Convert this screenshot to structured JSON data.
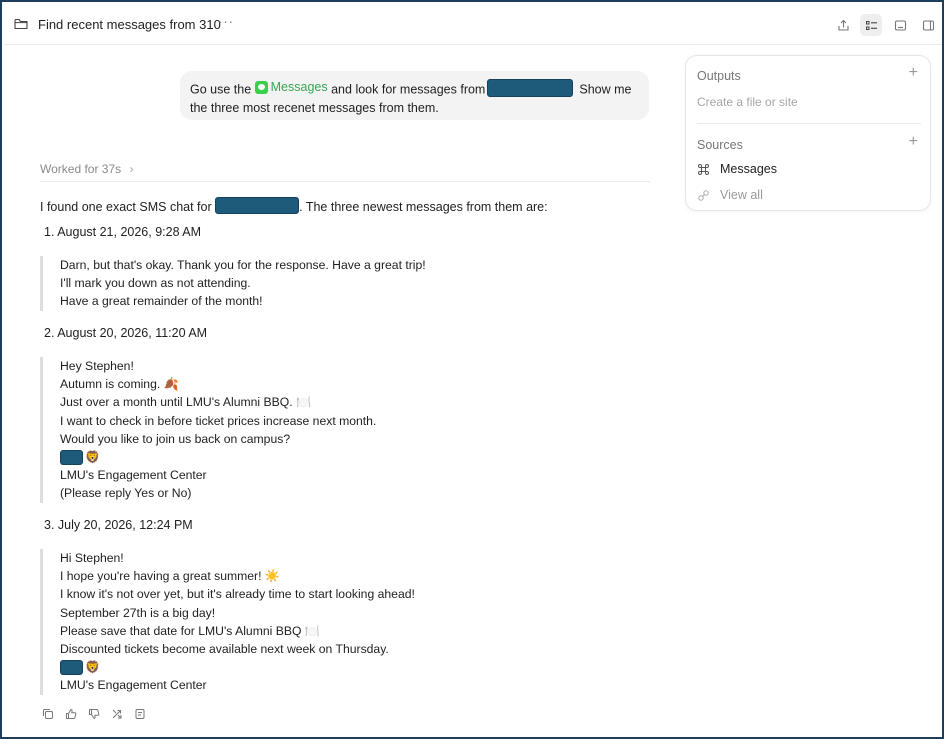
{
  "header": {
    "title": "Find recent messages from 310",
    "more": "···"
  },
  "user_message": {
    "prefix": "Go use the",
    "app_name": "Messages",
    "middle": "and look for messages from",
    "suffix_line1": "Show me",
    "line2": "the three most recenet messages from them."
  },
  "worked": {
    "label": "Worked for 37s",
    "chevron": "›"
  },
  "response": {
    "intro_prefix": "I found one exact SMS chat for",
    "intro_suffix": ". The three newest messages from them are:",
    "items": [
      {
        "head": "1.  August 21, 2026, 9:28 AM",
        "lines": [
          "Darn, but that's okay. Thank you for the response. Have a great trip!",
          "I'll mark you down as not attending.",
          "Have a great remainder of the month!"
        ]
      },
      {
        "head": "2.  August 20, 2026, 11:20 AM",
        "lines": [
          "Hey Stephen!",
          "Autumn is coming. 🍂",
          "Just over a month until LMU's Alumni BBQ. 🍽️",
          "I want to check in before ticket prices increase next month.",
          "Would you like to join us back on campus?"
        ],
        "sig_emoji": "🦁",
        "after": [
          "LMU's Engagement Center",
          "(Please reply Yes or No)"
        ]
      },
      {
        "head": "3.  July 20, 2026, 12:24 PM",
        "lines": [
          "Hi Stephen!",
          "I hope you're having a great summer! ☀️",
          "I know it's not over yet, but it's already time to start looking ahead!",
          "September 27th is a big day!",
          "Please save that date for LMU's Alumni BBQ 🍽️",
          "Discounted tickets become available next week on Thursday."
        ],
        "sig_emoji": "🦁",
        "after": [
          "LMU's Engagement Center"
        ]
      }
    ]
  },
  "panel": {
    "outputs_label": "Outputs",
    "outputs_sub": "Create a file or site",
    "sources_label": "Sources",
    "source_item": "Messages",
    "view_all": "View all",
    "plus": "+"
  },
  "colors": {
    "frame": "#1e3d5c",
    "redaction": "#1e5a7a",
    "messages_green": "#34a853"
  }
}
